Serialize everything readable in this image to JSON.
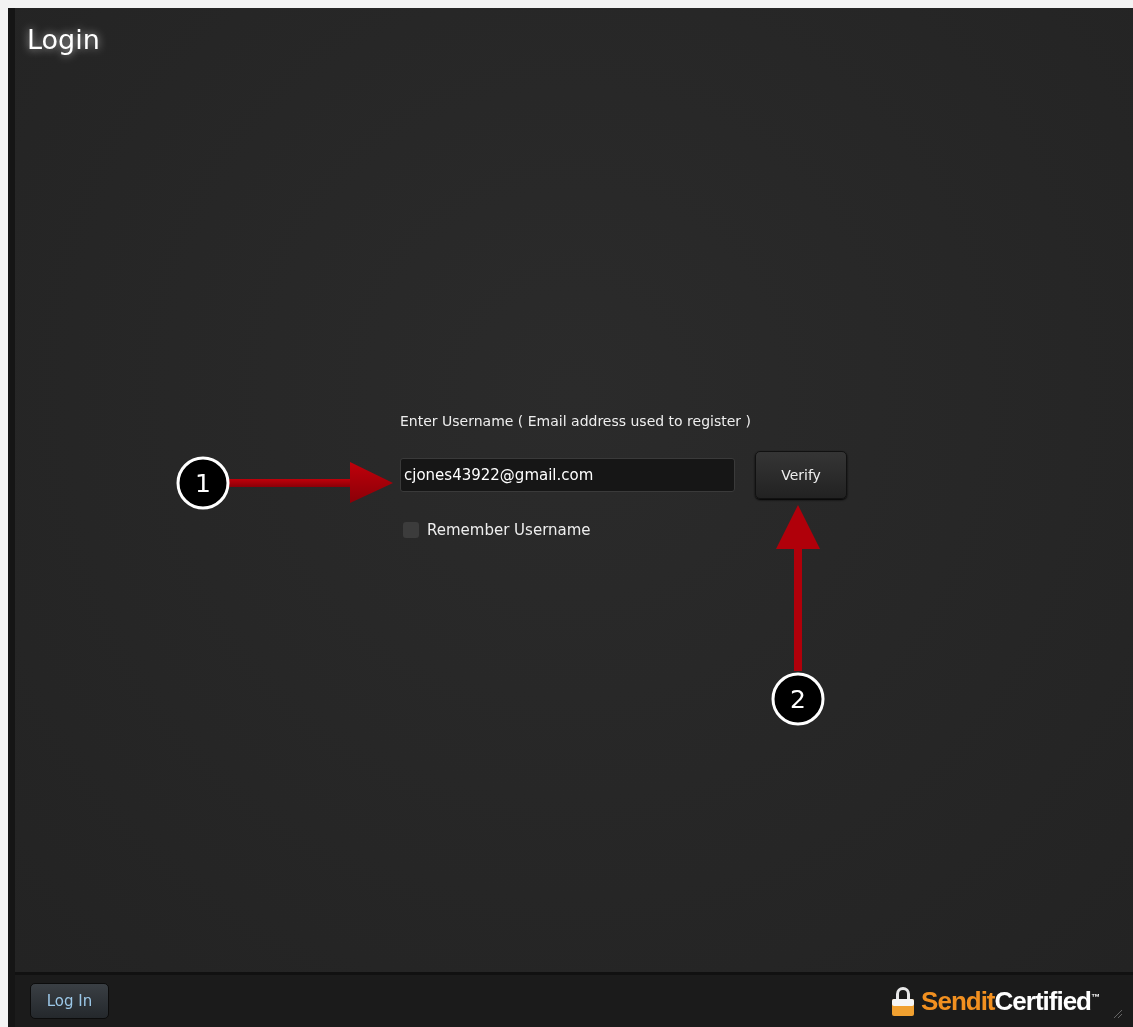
{
  "window": {
    "title": "Login"
  },
  "form": {
    "label": "Enter Username ( Email address used to register )",
    "username": {
      "value": "cjones43922@gmail.com"
    },
    "verify_button": "Verify",
    "remember": {
      "label": "Remember Username",
      "checked": false
    }
  },
  "footer": {
    "login_button": "Log In",
    "brand": {
      "primary": "Sendit",
      "secondary": "Certified",
      "trademark": "™"
    }
  },
  "callouts": [
    {
      "number": "1"
    },
    {
      "number": "2"
    }
  ]
}
